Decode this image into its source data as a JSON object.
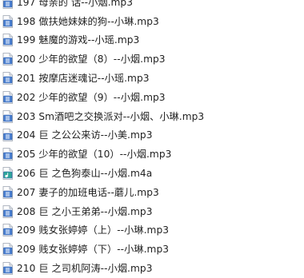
{
  "files": [
    {
      "name": "197 母亲的    话--小烟.mp3",
      "icon": "audio-file-icon"
    },
    {
      "name": "198 做扶她妹妹的狗--小琳.mp3",
      "icon": "audio-file-icon"
    },
    {
      "name": "199 魅魔的游戏--小瑶.mp3",
      "icon": "audio-file-icon"
    },
    {
      "name": "200 少年的欲望（8）--小烟.mp3",
      "icon": "audio-file-icon"
    },
    {
      "name": "201 按摩店迷魂记--小瑶.mp3",
      "icon": "audio-file-icon"
    },
    {
      "name": "202 少年的欲望（9）--小烟.mp3",
      "icon": "audio-file-icon"
    },
    {
      "name": "203 Sm酒吧之交换派对--小烟、小琳.mp3",
      "icon": "audio-file-icon"
    },
    {
      "name": "204 巨    之公公来访--小美.mp3",
      "icon": "audio-file-icon"
    },
    {
      "name": "205 少年的欲望（10）--小烟.mp3",
      "icon": "audio-file-icon"
    },
    {
      "name": "206 巨    之色狗泰山--小烟.m4a",
      "icon": "m4a-file-icon"
    },
    {
      "name": "207 妻子的加班电话--蘑儿.mp3",
      "icon": "audio-file-icon"
    },
    {
      "name": "208 巨    之小王弟弟--小烟.mp3",
      "icon": "audio-file-icon"
    },
    {
      "name": "209 贱女张婷婷（上）--小琳.mp3",
      "icon": "audio-file-icon"
    },
    {
      "name": "209 贱女张婷婷（下）--小琳.mp3",
      "icon": "audio-file-icon"
    },
    {
      "name": "210 巨    之司机阿涛--小烟.mp3",
      "icon": "audio-file-icon"
    }
  ],
  "colors": {
    "mp3_icon_bg": "#4a7fd0",
    "mp3_icon_border": "#2c5aa8",
    "m4a_icon_bg": "#2fa59a",
    "page_bg": "#ffffff"
  }
}
